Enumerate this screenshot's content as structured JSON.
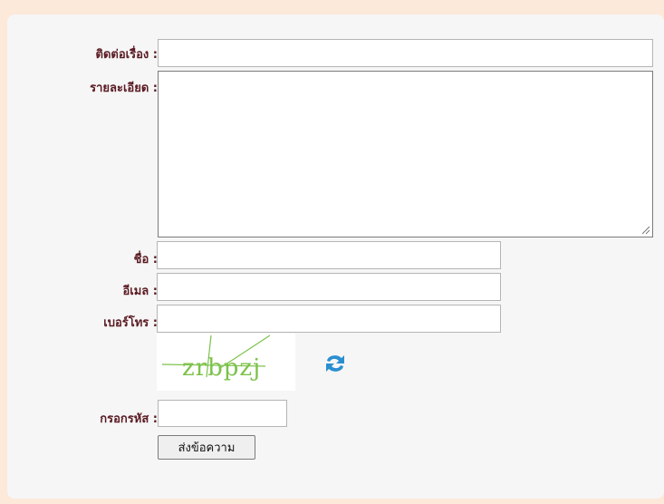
{
  "form": {
    "subject": {
      "label": "ติดต่อเรื่อง :",
      "value": ""
    },
    "detail": {
      "label": "รายละเอียด :",
      "value": ""
    },
    "name": {
      "label": "ชื่อ :",
      "value": ""
    },
    "email": {
      "label": "อีเมล :",
      "value": ""
    },
    "phone": {
      "label": "เบอร์โทร :",
      "value": ""
    },
    "captcha_text": "zrbpzj",
    "code": {
      "label": "กรอกรหัส :",
      "value": ""
    },
    "submit_label": "ส่งข้อความ"
  },
  "icons": {
    "refresh": "refresh-icon"
  },
  "colors": {
    "background": "#fde9da",
    "label": "#5a1a22",
    "captcha_text": "#7cc24a",
    "refresh": "#2a8fd0"
  }
}
